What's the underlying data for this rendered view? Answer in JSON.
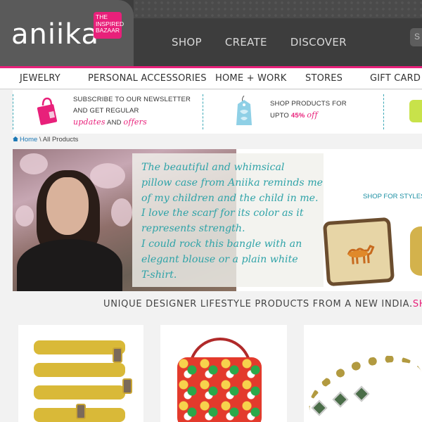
{
  "brand": {
    "logo_text": "aniika",
    "tag_line1": "THE",
    "tag_line2": "INSPIRED",
    "tag_line3": "BAZAAR"
  },
  "main_nav": [
    "SHOP",
    "CREATE",
    "DISCOVER"
  ],
  "search": {
    "stub_text": "S"
  },
  "category_nav": [
    "JEWELRY",
    "PERSONAL ACCESSORIES",
    "HOME + WORK",
    "STORES",
    "GIFT CARD"
  ],
  "promo": {
    "newsletter_line1": "SUBSCRIBE TO OUR NEWSLETTER",
    "newsletter_line2": "AND GET REGULAR",
    "newsletter_updates": "updates",
    "newsletter_and": "AND",
    "newsletter_offers": "offers",
    "sale_line1": "SHOP PRODUCTS FOR",
    "sale_upto": "UPTO",
    "sale_percent": "45%",
    "sale_off": "off"
  },
  "breadcrumb": {
    "home": "Home",
    "separator": "\\",
    "current": "All Products"
  },
  "hero": {
    "quote_lines": [
      "The beautiful and whimsical",
      "pillow case from Aniika reminds me",
      "of my children and the child in me.",
      "I love the scarf for its color as it",
      "represents strength.",
      "I could rock this bangle with an",
      "elegant blouse or a plain white",
      "T-shirt."
    ],
    "shop_styles": "SHOP FOR STYLES F"
  },
  "tagline": {
    "main": "UNIQUE DESIGNER LIFESTYLE PRODUCTS FROM A NEW INDIA.",
    "link": "SHOP ALL PR"
  },
  "colors": {
    "brand_pink": "#e8207a",
    "teal": "#2fa3a8",
    "header_dark": "#3d3d3d"
  },
  "icons": [
    "home-icon",
    "shopping-bag-icon",
    "price-tag-icon"
  ]
}
